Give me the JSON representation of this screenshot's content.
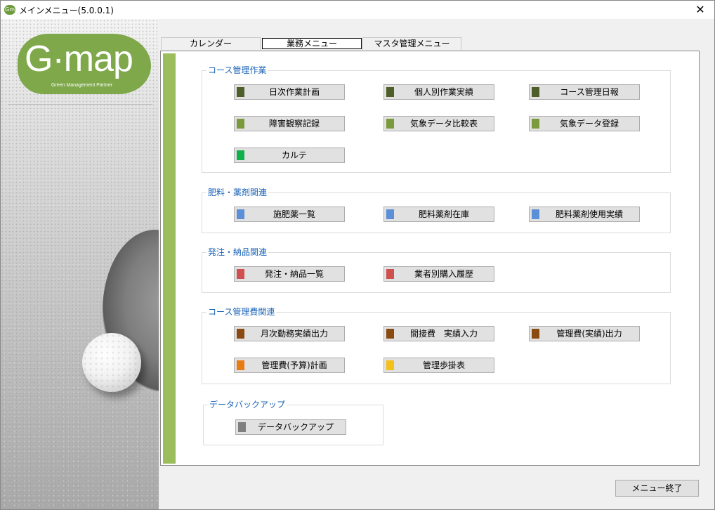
{
  "window": {
    "title": "メインメニュー(5.0.0.1)",
    "icon": "gm-app-icon",
    "close_glyph": "✕"
  },
  "logo": {
    "main": "G·map",
    "sub": "Green Management Partner"
  },
  "tabs": [
    {
      "label": "カレンダー"
    },
    {
      "label": "業務メニュー",
      "active": true
    },
    {
      "label": "マスタ管理メニュー"
    }
  ],
  "colors": {
    "accent_blue": "#1a63b5",
    "stripe_green": "#9bbd5c",
    "dark_olive": "#4f5f2c",
    "olive": "#7a9a3c",
    "bright_green": "#11b04b",
    "blue": "#5b8fd8",
    "red": "#d0504f",
    "brown": "#8a4a10",
    "orange": "#e87b14",
    "yellow": "#f4c01a",
    "gray": "#7f7f7f"
  },
  "groups": {
    "course_work": {
      "title": "コース管理作業",
      "buttons": [
        {
          "label": "日次作業計画",
          "color": "#4f5f2c"
        },
        {
          "label": "個人別作業実績",
          "color": "#4f5f2c"
        },
        {
          "label": "コース管理日報",
          "color": "#4f5f2c"
        },
        {
          "label": "障害観察記録",
          "color": "#7a9a3c"
        },
        {
          "label": "気象データ比較表",
          "color": "#7a9a3c"
        },
        {
          "label": "気象データ登録",
          "color": "#7a9a3c"
        },
        {
          "label": "カルテ",
          "color": "#11b04b"
        }
      ]
    },
    "fertilizer": {
      "title": "肥料・薬剤関連",
      "buttons": [
        {
          "label": "施肥薬一覧",
          "color": "#5b8fd8"
        },
        {
          "label": "肥料薬剤在庫",
          "color": "#5b8fd8"
        },
        {
          "label": "肥料薬剤使用実績",
          "color": "#5b8fd8"
        }
      ]
    },
    "orders": {
      "title": "発注・納品関連",
      "buttons": [
        {
          "label": "発注・納品一覧",
          "color": "#d0504f"
        },
        {
          "label": "業者別購入履歴",
          "color": "#d0504f"
        }
      ]
    },
    "costs": {
      "title": "コース管理費関連",
      "buttons": [
        {
          "label": "月次勤務実績出力",
          "color": "#8a4a10"
        },
        {
          "label": "間接費　実績入力",
          "color": "#8a4a10"
        },
        {
          "label": "管理費(実績)出力",
          "color": "#8a4a10"
        },
        {
          "label": "管理費(予算)計画",
          "color": "#e87b14"
        },
        {
          "label": "管理歩掛表",
          "color": "#f4c01a"
        }
      ]
    },
    "backup": {
      "title": "データバックアップ",
      "buttons": [
        {
          "label": "データバックアップ",
          "color": "#7f7f7f"
        }
      ]
    }
  },
  "footer": {
    "exit_label": "メニュー終了"
  }
}
